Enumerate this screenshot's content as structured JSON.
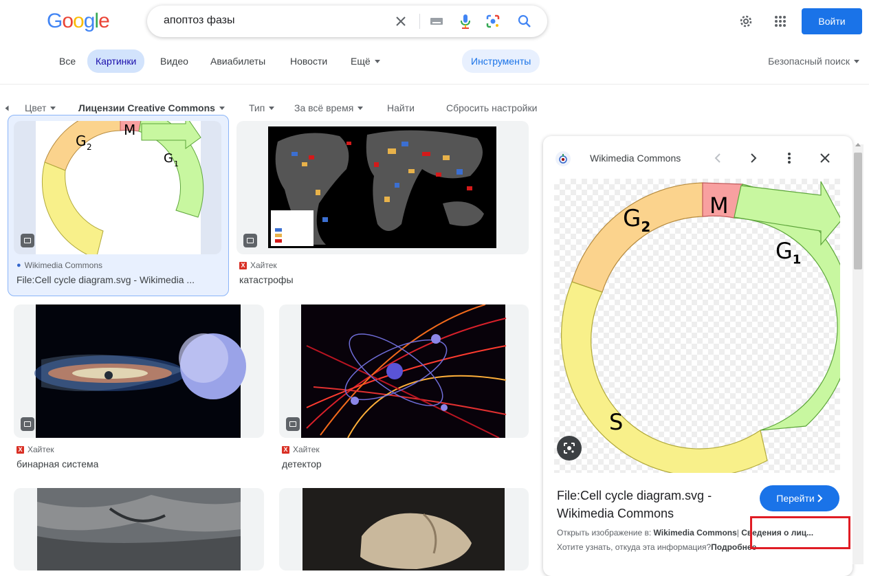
{
  "header": {
    "logo_text": "Google",
    "search_value": "апоптоз фазы",
    "signin_label": "Войти",
    "icons": [
      "clear-icon",
      "keyboard-icon",
      "mic-icon",
      "lens-icon",
      "search-icon",
      "gear-icon",
      "apps-icon"
    ]
  },
  "tabs": [
    {
      "label": "Все"
    },
    {
      "label": "Картинки"
    },
    {
      "label": "Видео"
    },
    {
      "label": "Авиабилеты"
    },
    {
      "label": "Новости"
    },
    {
      "label": "Ещё"
    }
  ],
  "tools_label": "Инструменты",
  "safesearch_label": "Безопасный поиск",
  "filters": {
    "color": "Цвет",
    "license": "Лицензии Creative Commons",
    "type": "Тип",
    "time": "За всё время",
    "find": "Найти",
    "reset": "Сбросить настройки"
  },
  "results": [
    {
      "source": "Wikimedia Commons",
      "title": "File:Cell cycle diagram.svg - Wikimedia ..."
    },
    {
      "source": "Хайтек",
      "title": "катастрофы"
    },
    {
      "source": "Хайтек",
      "title": "бинарная система"
    },
    {
      "source": "Хайтек",
      "title": "детектор"
    }
  ],
  "panel": {
    "source": "Wikimedia Commons",
    "title": "File:Cell cycle diagram.svg - Wikimedia Commons",
    "visit_label": "Перейти",
    "open_in_prefix": "Открыть изображение в:",
    "open_in_link": "Wikimedia Commons",
    "license_info": "Сведения о лиц...",
    "where_from": "Хотите узнать, откуда эта информация?",
    "more_link": "Подробнее",
    "diagram_labels": {
      "g2": "G",
      "g2_sub": "2",
      "m": "M",
      "g1": "G",
      "g1_sub": "1",
      "s": "S"
    }
  },
  "colors": {
    "accent": "#1a73e8",
    "highlight_box": "#e01c24",
    "g2_phase": "#fbd38d",
    "m_phase": "#f8a0a0",
    "g1_phase": "#c8f7a0",
    "s_phase": "#f8f08a"
  }
}
